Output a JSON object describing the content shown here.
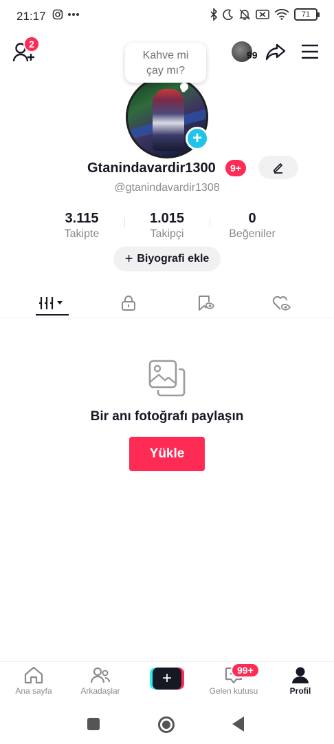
{
  "status_bar": {
    "time": "21:17",
    "extra_icons": [
      "instagram-icon",
      "more-dots-icon"
    ],
    "right_icons": [
      "bluetooth-icon",
      "moon-icon",
      "mute-icon",
      "no-sim-icon",
      "wifi-icon"
    ],
    "battery": "71"
  },
  "header": {
    "add_friend_badge": "2",
    "story_count": "99"
  },
  "profile": {
    "note_bubble": "Kahve mi\nçay mı?",
    "display_name": "Gtanindavardir1300",
    "name_badge": "9+",
    "handle": "@gtanindavardir1308",
    "stats": [
      {
        "value": "3.115",
        "label": "Takipte"
      },
      {
        "value": "1.015",
        "label": "Takipçi"
      },
      {
        "value": "0",
        "label": "Beğeniler"
      }
    ],
    "bio_button": "Biyografi ekle"
  },
  "tabs": [
    {
      "icon": "grid-icon",
      "active": true
    },
    {
      "icon": "lock-icon",
      "active": false
    },
    {
      "icon": "saved-icon",
      "active": false
    },
    {
      "icon": "liked-icon",
      "active": false
    }
  ],
  "empty_state": {
    "title": "Bir anı fotoğrafı paylaşın",
    "button": "Yükle"
  },
  "bottom_nav": {
    "items": [
      {
        "label": "Ana sayfa",
        "icon": "home-icon"
      },
      {
        "label": "Arkadaşlar",
        "icon": "friends-icon"
      },
      {
        "label": "",
        "icon": "create-icon"
      },
      {
        "label": "Gelen kutusu",
        "icon": "inbox-icon"
      },
      {
        "label": "Profil",
        "icon": "profile-icon"
      }
    ],
    "inbox_badge": "99+"
  },
  "colors": {
    "accent": "#fe2c55",
    "cyan": "#20c4e8",
    "text": "#161823",
    "muted": "#8a8b91"
  }
}
